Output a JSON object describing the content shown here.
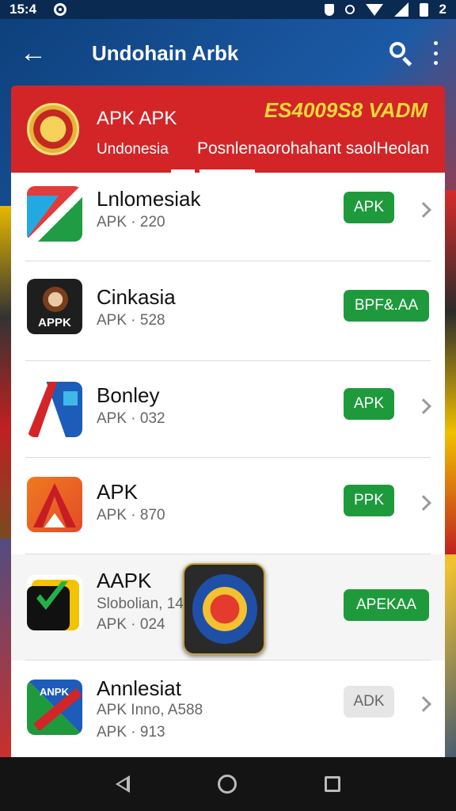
{
  "status_bar": {
    "time": "15:4",
    "battery_text": "2",
    "icons": [
      "target-icon",
      "shield-icon",
      "dot-icon",
      "wifi-icon",
      "signal-icon",
      "battery-icon"
    ]
  },
  "app_bar": {
    "title": "Undohain Arbk",
    "icons": [
      "back-arrow-icon",
      "search-icon",
      "more-vert-icon"
    ]
  },
  "banner": {
    "title": "APK APK",
    "subtitle": "Undonesia",
    "right_title": "ES4009S8 VADM",
    "right_subtitle": "Posnlenaorohahant saolHeolan"
  },
  "apps": [
    {
      "name": "Lnlomesiak",
      "meta": "APK · 220",
      "action": "APK",
      "style": "green"
    },
    {
      "name": "Cinkasia",
      "meta": "APK · 528",
      "action": "BPF&.AA",
      "style": "green"
    },
    {
      "name": "Bonley",
      "meta": "APK · 032",
      "action": "APK",
      "style": "green"
    },
    {
      "name": "APK",
      "meta": "APK · 870",
      "action": "PPK",
      "style": "green"
    },
    {
      "name": "AAPK",
      "meta": "Slobolian, 14",
      "meta2": "APK · 024",
      "action": "APEKAA",
      "style": "green"
    },
    {
      "name": "Annlesiat",
      "meta": "APK Inno, A588",
      "meta2": "APK · 913",
      "action": "ADK",
      "style": "grey"
    }
  ],
  "icon_labels": {
    "app2": "APPK",
    "app6": "ANPK"
  },
  "colors": {
    "primary_red": "#d32527",
    "action_green": "#1e9a3c",
    "banner_yellow": "#f8d93a",
    "nav_bar": "#141414"
  }
}
